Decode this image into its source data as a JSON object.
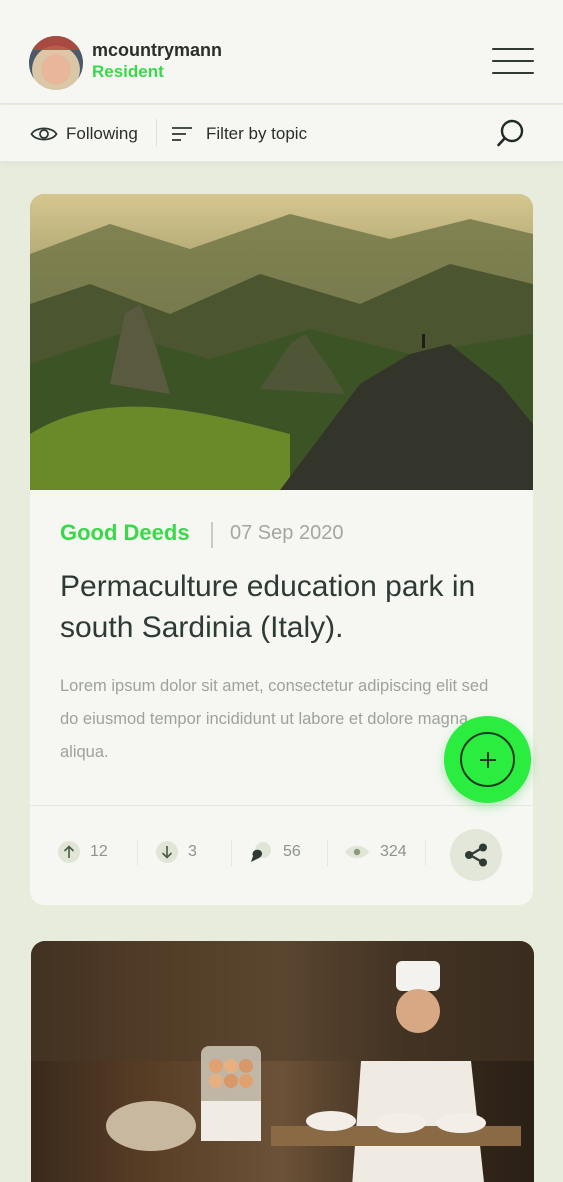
{
  "header": {
    "username": "mcountrymann",
    "role": "Resident"
  },
  "subbar": {
    "following_label": "Following",
    "filter_label": "Filter by topic"
  },
  "post": {
    "category": "Good Deeds",
    "date": "07 Sep 2020",
    "title": "Permaculture education park in south Sardinia (Italy).",
    "excerpt": "Lorem ipsum dolor sit amet, consectetur adipiscing elit sed do eiusmod tempor incididunt ut labore et dolore magna aliqua.",
    "stats": {
      "upvotes": "12",
      "downvotes": "3",
      "comments": "56",
      "views": "324"
    }
  },
  "colors": {
    "accent_green": "#39d94a",
    "fab_green": "#2bed3f",
    "background": "#e8ecdc",
    "card": "#f6f7f3",
    "text_dark": "#2f3a34",
    "text_muted": "#9ea39a"
  },
  "icons": {
    "following": "eye-icon",
    "filter": "filter-lines-icon",
    "search": "search-icon",
    "menu": "hamburger-menu-icon",
    "upvote": "arrow-up-icon",
    "downvote": "arrow-down-icon",
    "comments": "comment-bubble-icon",
    "views": "eye-icon",
    "share": "share-icon",
    "add": "plus-icon"
  }
}
